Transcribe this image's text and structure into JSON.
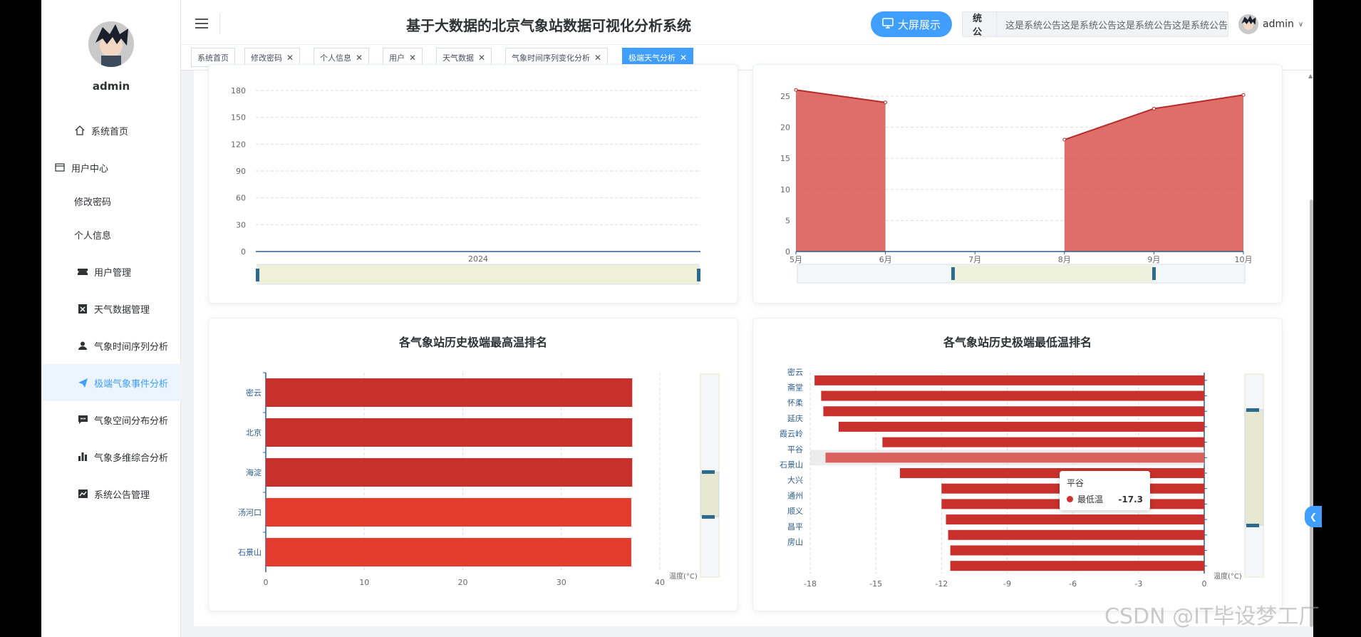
{
  "sidebar": {
    "username": "admin",
    "items": [
      {
        "label": "系统首页",
        "icon": "home-icon"
      },
      {
        "label": "用户中心",
        "icon": "user-center-icon"
      },
      {
        "label": "修改密码",
        "icon": ""
      },
      {
        "label": "个人信息",
        "icon": ""
      },
      {
        "label": "用户管理",
        "icon": "ticket-icon"
      },
      {
        "label": "天气数据管理",
        "icon": "clipboard-icon"
      },
      {
        "label": "气象时间序列分析",
        "icon": "person-icon"
      },
      {
        "label": "极端气象事件分析",
        "icon": "send-icon",
        "active": true
      },
      {
        "label": "气象空间分布分析",
        "icon": "message-icon"
      },
      {
        "label": "气象多维综合分析",
        "icon": "bar-chart-icon"
      },
      {
        "label": "系统公告管理",
        "icon": "line-chart-icon"
      }
    ]
  },
  "header": {
    "title": "基于大数据的北京气象站数据可视化分析系统",
    "big_screen_label": "大屏展示",
    "notice_label": "系统公告",
    "notice_text": "这是系统公告这是系统公告这是系统公告这是系统公告",
    "username": "admin"
  },
  "tabs": [
    {
      "label": "系统首页",
      "closable": false
    },
    {
      "label": "修改密码",
      "closable": true
    },
    {
      "label": "个人信息",
      "closable": true
    },
    {
      "label": "用户",
      "closable": true
    },
    {
      "label": "天气数据",
      "closable": true
    },
    {
      "label": "气象时间序列变化分析",
      "closable": true
    },
    {
      "label": "极端天气分析",
      "closable": true,
      "active": true
    }
  ],
  "colors": {
    "accent": "#409eff",
    "bar_dark": "#c9302c",
    "bar_light": "#e33b2e",
    "area": "#d9534f"
  },
  "tooltip": {
    "name": "平谷",
    "series": "最低温",
    "value": "-17.3"
  },
  "watermark": "CSDN @IT毕设梦工厂",
  "chart_data": [
    {
      "type": "line",
      "title": "",
      "x_tick": "2024",
      "ylim": [
        0,
        180
      ],
      "yticks": [
        "0",
        "30",
        "60",
        "90",
        "120",
        "150",
        "180"
      ],
      "values": []
    },
    {
      "type": "area",
      "title": "",
      "categories": [
        "5月",
        "6月",
        "7月",
        "8月",
        "9月",
        "10月"
      ],
      "values": [
        26,
        24,
        null,
        18,
        23,
        25.2
      ],
      "ylim": [
        0,
        25
      ],
      "yticks": [
        "0",
        "5",
        "10",
        "15",
        "20",
        "25"
      ]
    },
    {
      "type": "bar",
      "orientation": "horizontal",
      "title": "各气象站历史极端最高温排名",
      "categories": [
        "密云",
        "北京",
        "海淀",
        "汤河口",
        "石景山"
      ],
      "values": [
        37.2,
        37.2,
        37.2,
        37.1,
        37.1
      ],
      "xlim": [
        0,
        40
      ],
      "xticks": [
        "0",
        "10",
        "20",
        "30",
        "40"
      ],
      "xlabel": "温度(°C)"
    },
    {
      "type": "bar",
      "orientation": "horizontal",
      "title": "各气象站历史极端最低温排名",
      "categories": [
        "密云",
        "斋堂",
        "怀柔",
        "延庆",
        "霞云岭",
        "平谷",
        "石景山",
        "大兴",
        "通州",
        "顺义",
        "昌平",
        "房山"
      ],
      "values": [
        -17.8,
        -17.5,
        -17.4,
        -16.7,
        -14.7,
        -17.3,
        -13.9,
        -12.0,
        -12.0,
        -11.8,
        -11.7,
        -11.6,
        -11.6
      ],
      "xlim": [
        -18,
        0
      ],
      "xticks": [
        "-18",
        "-15",
        "-12",
        "-9",
        "-6",
        "-3",
        "0"
      ],
      "xlabel": "温度(°C)"
    }
  ]
}
